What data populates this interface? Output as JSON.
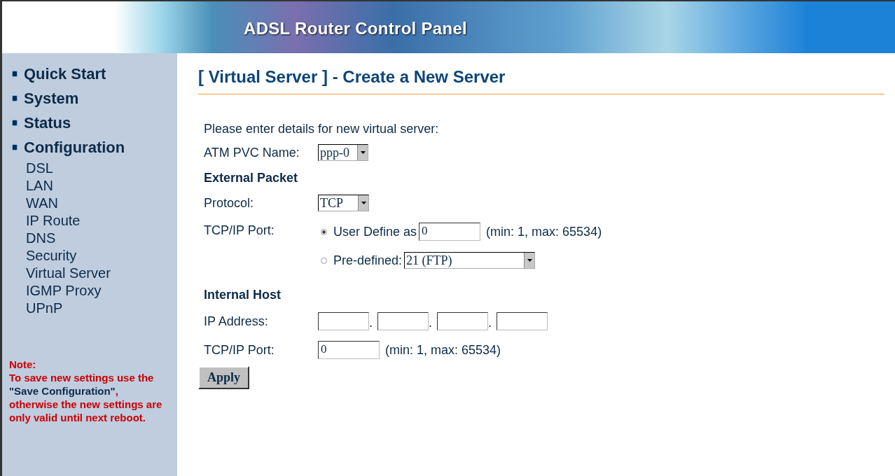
{
  "banner": {
    "title": "ADSL Router Control Panel"
  },
  "sidebar": {
    "items": [
      {
        "label": "Quick Start",
        "kind": "section"
      },
      {
        "label": "System",
        "kind": "section"
      },
      {
        "label": "Status",
        "kind": "section"
      },
      {
        "label": "Configuration",
        "kind": "section"
      },
      {
        "label": "DSL",
        "kind": "sub"
      },
      {
        "label": "LAN",
        "kind": "sub"
      },
      {
        "label": "WAN",
        "kind": "sub"
      },
      {
        "label": "IP Route",
        "kind": "sub"
      },
      {
        "label": "DNS",
        "kind": "sub"
      },
      {
        "label": "Security",
        "kind": "sub"
      },
      {
        "label": "Virtual Server",
        "kind": "sub"
      },
      {
        "label": "IGMP Proxy",
        "kind": "sub"
      },
      {
        "label": "UPnP",
        "kind": "sub"
      }
    ],
    "note": {
      "title": "Note:",
      "before": "To save new settings use the ",
      "link": "\"Save Configuration\"",
      "after": ", otherwise the new settings are only valid until next reboot."
    }
  },
  "page_title": "[ Virtual Server ] - Create a New Server",
  "intro": "Please enter details for new virtual server:",
  "atm_pvc": {
    "label": "ATM PVC Name:",
    "value": "ppp-0"
  },
  "external_heading": "External Packet",
  "protocol": {
    "label": "Protocol:",
    "value": "TCP"
  },
  "external_port": {
    "label": "TCP/IP Port:",
    "options": [
      {
        "label": "User Define as",
        "kind": "input",
        "selected": true,
        "value": "0",
        "hint": "(min: 1, max: 65534)"
      },
      {
        "label": "Pre-defined:",
        "kind": "dropdown",
        "selected": false,
        "value": "21 (FTP)"
      }
    ]
  },
  "internal_heading": "Internal Host",
  "ip_address": {
    "label": "IP Address:",
    "separator": "."
  },
  "internal_port": {
    "label": "TCP/IP Port:",
    "value": "0",
    "hint": "(min: 1, max: 65534)"
  },
  "apply_button": "Apply"
}
